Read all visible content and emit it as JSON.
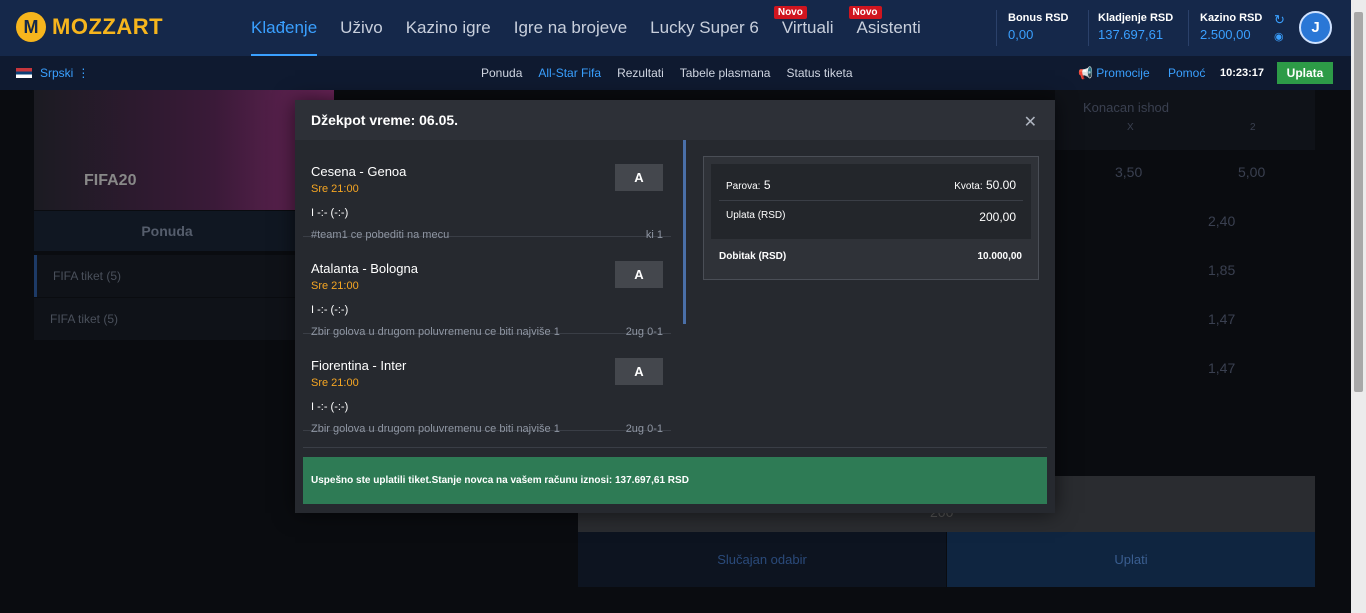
{
  "brand": {
    "logo_letter": "M",
    "name": "MOZZART"
  },
  "nav": {
    "items": [
      {
        "label": "Klađenje",
        "badge": ""
      },
      {
        "label": "Uživo",
        "badge": ""
      },
      {
        "label": "Kazino igre",
        "badge": ""
      },
      {
        "label": "Igre na brojeve",
        "badge": ""
      },
      {
        "label": "Lucky Super 6",
        "badge": ""
      },
      {
        "label": "Virtuali",
        "badge": "Novo"
      },
      {
        "label": "Asistenti",
        "badge": "Novo"
      }
    ]
  },
  "accounts": {
    "bonus": {
      "label": "Bonus RSD",
      "value": "0,00"
    },
    "kladjenje": {
      "label": "Kladjenje RSD",
      "value": "137.697,61"
    },
    "kazino": {
      "label": "Kazino RSD",
      "value": "2.500,00"
    }
  },
  "user": {
    "avatar_initial": "J"
  },
  "subbar": {
    "language": "Srpski",
    "links": [
      "Ponuda",
      "All-Star Fifa",
      "Rezultati",
      "Tabele plasmana",
      "Status tiketa"
    ],
    "promo": "Promocije",
    "help": "Pomoć",
    "time": "10:23:17",
    "deposit": "Uplata"
  },
  "background": {
    "banner_text": "FIFA20",
    "tab": "Ponuda",
    "items": [
      "FIFA tiket (5)",
      "FIFA tiket (5)"
    ],
    "final_result": "Konacan ishod",
    "col_x": "X",
    "col_2": "2",
    "odds": [
      "3,50",
      "5,00",
      "2,40",
      "1,85",
      "1,47",
      "1,47"
    ],
    "stake": "200",
    "random_pick": "Slučajan odabir",
    "pay": "Uplati"
  },
  "modal": {
    "title": "Džekpot vreme: 06.05.",
    "matches": [
      {
        "teams": "Cesena - Genoa",
        "time": "Sre 21:00",
        "score": "I -:- (-:-)",
        "pick": "#team1 ce pobediti na mecu",
        "odd": "ki 1",
        "btn": "A"
      },
      {
        "teams": "Atalanta - Bologna",
        "time": "Sre 21:00",
        "score": "I -:- (-:-)",
        "pick": "Zbir golova u drugom poluvremenu ce biti najviše 1",
        "odd": "2ug 0-1",
        "btn": "A"
      },
      {
        "teams": "Fiorentina - Inter",
        "time": "Sre 21:00",
        "score": "I -:- (-:-)",
        "pick": "Zbir golova u drugom poluvremenu ce biti najviše 1",
        "odd": "2ug 0-1",
        "btn": "A"
      }
    ],
    "ticket": {
      "pairs_label": "Parova:",
      "pairs_value": "5",
      "odds_label": "Kvota:",
      "odds_value": "50.00",
      "stake_label": "Uplata",
      "stake_unit": "(RSD)",
      "stake_value": "200,00",
      "win_label": "Dobitak",
      "win_unit": "(RSD)",
      "win_value": "10.000,00"
    },
    "success_message": "Uspešno ste uplatili tiket.Stanje novca na vašem računu iznosi: 137.697,61 RSD"
  }
}
